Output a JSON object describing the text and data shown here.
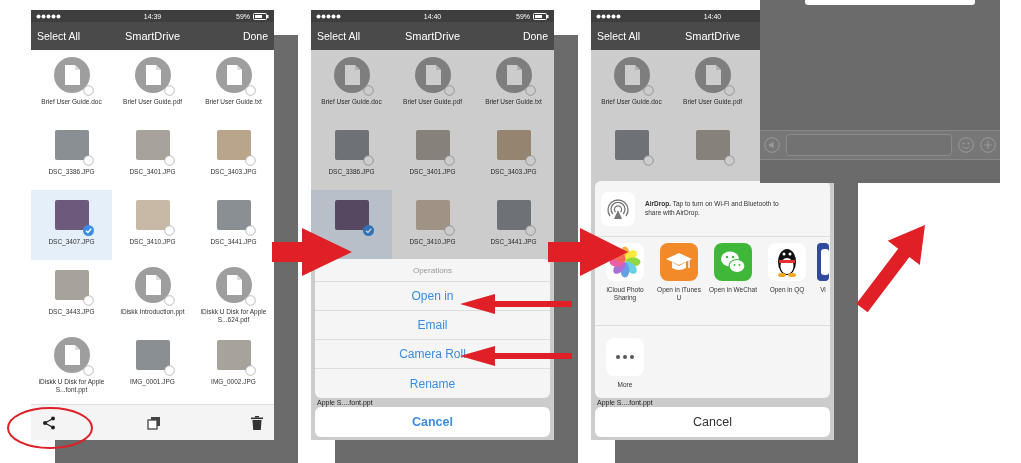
{
  "screens": [
    {
      "kind": "file_browser",
      "status": {
        "time": "14:39",
        "battery": "59%"
      },
      "nav": {
        "select_all": "Select All",
        "title": "SmartDrive",
        "done": "Done"
      },
      "dimmed": false,
      "toolbar": true,
      "file_rows": [
        [
          {
            "kind": "doc",
            "name": "Brief User Guide.doc",
            "selected": false
          },
          {
            "kind": "doc",
            "name": "Brief User Guide.pdf",
            "selected": false
          },
          {
            "kind": "doc",
            "name": "Brief User Guide.txt",
            "selected": false
          }
        ],
        [
          {
            "kind": "photo",
            "name": "DSC_3386.JPG",
            "selected": false
          },
          {
            "kind": "photo",
            "name": "DSC_3401.JPG",
            "selected": false
          },
          {
            "kind": "photo",
            "name": "DSC_3403.JPG",
            "selected": false
          }
        ],
        [
          {
            "kind": "photo",
            "name": "DSC_3407.JPG",
            "selected": true
          },
          {
            "kind": "photo",
            "name": "DSC_3410.JPG",
            "selected": false
          },
          {
            "kind": "photo",
            "name": "DSC_3441.JPG",
            "selected": false
          }
        ],
        [
          {
            "kind": "photo",
            "name": "DSC_3443.JPG",
            "selected": false
          },
          {
            "kind": "doc",
            "name": "iDiskk Introduction.ppt",
            "selected": false
          },
          {
            "kind": "doc",
            "name": "iDiskk U Disk for Apple S...624.pdf",
            "selected": false
          }
        ],
        [
          {
            "kind": "doc",
            "name": "iDiskk U Disk for Apple S...font.ppt",
            "selected": false
          },
          {
            "kind": "photo",
            "name": "IMG_0001.JPG",
            "selected": false
          },
          {
            "kind": "photo",
            "name": "IMG_0002.JPG",
            "selected": false
          }
        ]
      ]
    },
    {
      "kind": "file_browser",
      "status": {
        "time": "14:40",
        "battery": "59%"
      },
      "nav": {
        "select_all": "Select All",
        "title": "SmartDrive",
        "done": "Done"
      },
      "dimmed": true,
      "toolbar": false,
      "file_rows": [
        [
          {
            "kind": "doc",
            "name": "Brief User Guide.doc",
            "selected": false
          },
          {
            "kind": "doc",
            "name": "Brief User Guide.pdf",
            "selected": false
          },
          {
            "kind": "doc",
            "name": "Brief User Guide.txt",
            "selected": false
          }
        ],
        [
          {
            "kind": "photo",
            "name": "DSC_3386.JPG",
            "selected": false
          },
          {
            "kind": "photo",
            "name": "DSC_3401.JPG",
            "selected": false
          },
          {
            "kind": "photo",
            "name": "DSC_3403.JPG",
            "selected": false
          }
        ],
        [
          {
            "kind": "photo",
            "selected": true
          },
          {
            "kind": "photo",
            "name": "DSC_3410.JPG",
            "selected": false
          },
          {
            "kind": "photo",
            "name": "DSC_3441.JPG",
            "selected": false
          }
        ]
      ],
      "sheet": {
        "kind": "operations",
        "title": "Operations",
        "options": [
          "Open in",
          "Email",
          "Camera Roll",
          "Rename"
        ],
        "peek_text": "Apple S....font.ppt",
        "cancel": "Cancel"
      }
    },
    {
      "kind": "file_browser",
      "status": {
        "time": "14:40"
      },
      "nav": {
        "select_all": "Select All",
        "title": "SmartDrive"
      },
      "dimmed": true,
      "toolbar": false,
      "file_rows": [
        [
          {
            "kind": "doc",
            "name": "Brief User Guide.doc",
            "selected": false
          },
          {
            "kind": "doc",
            "name": "Brief User Guide.pdf",
            "selected": false
          }
        ],
        [
          {
            "kind": "photo",
            "selected": false
          },
          {
            "kind": "photo",
            "selected": false
          }
        ]
      ],
      "sheet": {
        "kind": "share",
        "airdrop": "**AirDrop.** Tap to turn on Wi-Fi and Bluetooth to share with AirDrop.",
        "apps": [
          {
            "kind": "photos",
            "label": "iCloud Photo Sharing"
          },
          {
            "kind": "itunes_u",
            "label": "Open in iTunes U"
          },
          {
            "kind": "wechat",
            "label": "Open in WeChat"
          },
          {
            "kind": "qq",
            "label": "Open in QQ"
          },
          {
            "kind": "partial",
            "label": "Vi"
          }
        ],
        "actions": [
          {
            "kind": "more",
            "label": "More"
          }
        ],
        "peek_text": "Apple S....font.ppt",
        "cancel": "Cancel"
      }
    },
    {
      "kind": "chat"
    }
  ]
}
